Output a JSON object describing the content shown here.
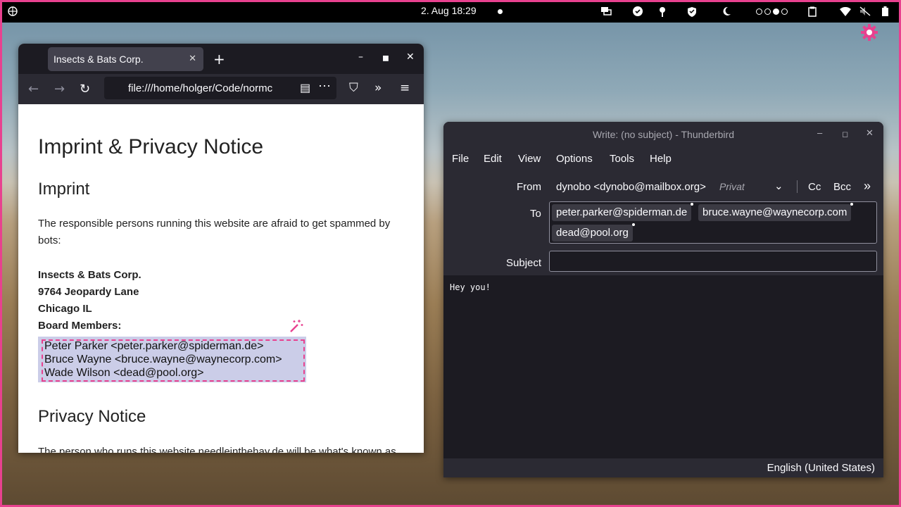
{
  "topbar": {
    "clock": "2. Aug  18:29"
  },
  "browser": {
    "tab_title": "Insects & Bats Corp.",
    "url": "file:///home/holger/Code/normc",
    "page": {
      "h1": "Imprint & Privacy Notice",
      "imprint_heading": "Imprint",
      "intro": "The responsible persons running this website are afraid to get spammed by bots:",
      "company": "Insects & Bats Corp.",
      "street": "9764 Jeopardy Lane",
      "city": "Chicago IL",
      "board_label": "Board Members:",
      "members": [
        "Peter Parker <peter.parker@spiderman.de>",
        "Bruce Wayne <bruce.wayne@waynecorp.com>",
        "Wade Wilson <dead@pool.org>"
      ],
      "privacy_heading": "Privacy Notice",
      "privacy_text": "The person who runs this website needleinthehay.de will be what's known as"
    }
  },
  "thunderbird": {
    "title": "Write: (no subject) - Thunderbird",
    "menu": [
      "File",
      "Edit",
      "View",
      "Options",
      "Tools",
      "Help"
    ],
    "from_label": "From",
    "from_value": "dynobo <dynobo@mailbox.org>",
    "from_identity": "Privat",
    "cc": "Cc",
    "bcc": "Bcc",
    "to_label": "To",
    "recipients": [
      "peter.parker@spiderman.de",
      "bruce.wayne@waynecorp.com",
      "dead@pool.org"
    ],
    "subject_label": "Subject",
    "subject_value": "",
    "body": "Hey you!",
    "language": "English (United States)"
  },
  "colors": {
    "accent": "#e8418f",
    "selection": "#cbcde8"
  }
}
